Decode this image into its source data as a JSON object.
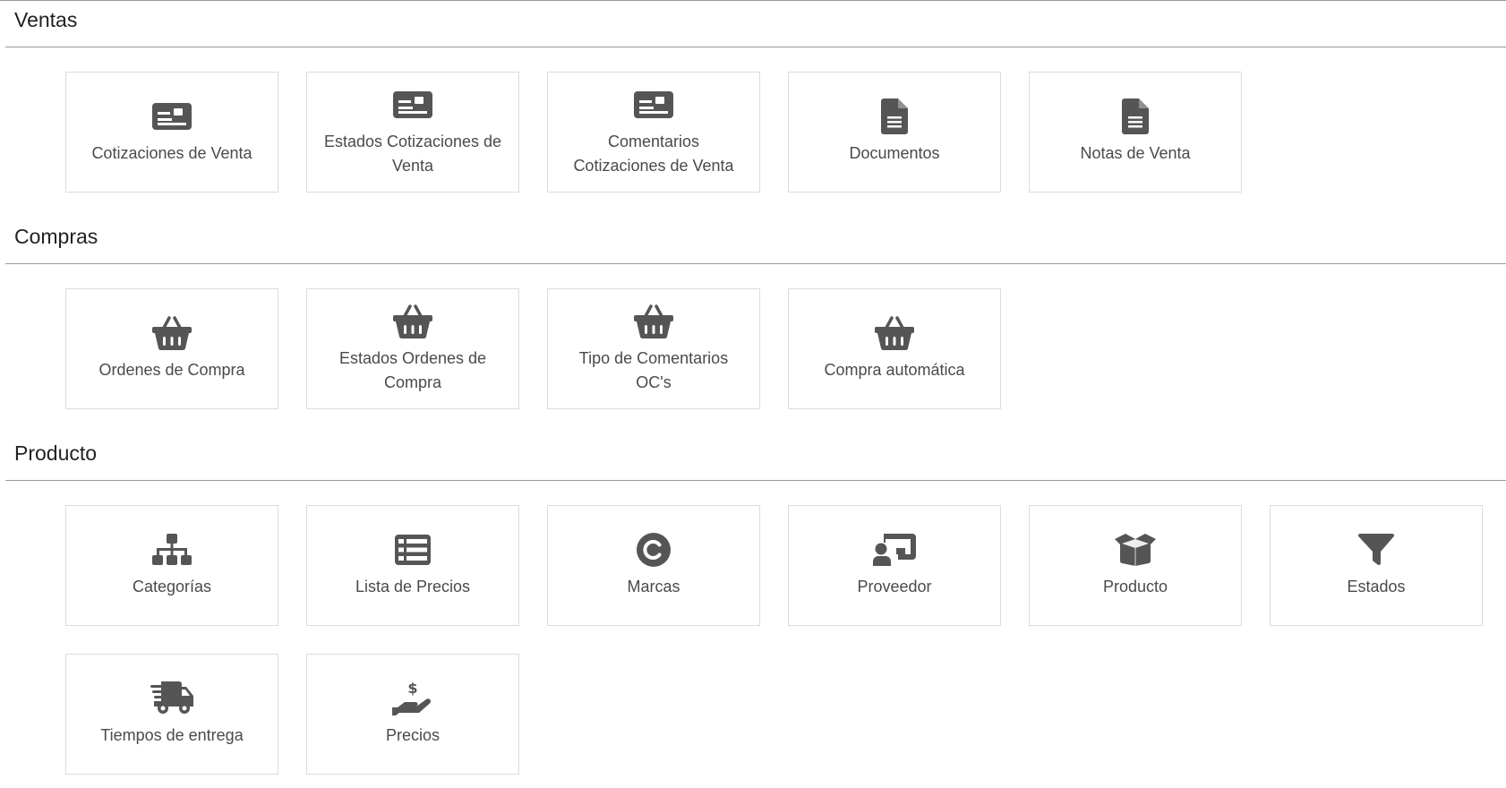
{
  "sections": {
    "ventas": {
      "title": "Ventas",
      "tiles": [
        {
          "label": "Cotizaciones de Venta",
          "icon": "id-card-icon"
        },
        {
          "label": "Estados Cotizaciones de Venta",
          "icon": "id-card-icon"
        },
        {
          "label": "Comentarios Cotizaciones de Venta",
          "icon": "id-card-icon"
        },
        {
          "label": "Documentos",
          "icon": "file-lines-icon"
        },
        {
          "label": "Notas de Venta",
          "icon": "file-lines-icon"
        }
      ]
    },
    "compras": {
      "title": "Compras",
      "tiles": [
        {
          "label": "Ordenes de Compra",
          "icon": "basket-icon"
        },
        {
          "label": "Estados Ordenes de Compra",
          "icon": "basket-icon"
        },
        {
          "label": "Tipo de Comentarios OC's",
          "icon": "basket-icon"
        },
        {
          "label": "Compra automática",
          "icon": "basket-icon"
        }
      ]
    },
    "producto": {
      "title": "Producto",
      "tiles": [
        {
          "label": "Categorías",
          "icon": "sitemap-icon"
        },
        {
          "label": "Lista de Precios",
          "icon": "list-icon"
        },
        {
          "label": "Marcas",
          "icon": "copyright-icon"
        },
        {
          "label": "Proveedor",
          "icon": "chalkboard-user-icon"
        },
        {
          "label": "Producto",
          "icon": "box-open-icon"
        },
        {
          "label": "Estados",
          "icon": "filter-icon"
        },
        {
          "label": "Tiempos de entrega",
          "icon": "truck-fast-icon"
        },
        {
          "label": "Precios",
          "icon": "hand-holding-dollar-icon"
        }
      ]
    }
  },
  "colors": {
    "icon": "#555555",
    "tile_border": "#dcdcdc",
    "rule": "#9a9a9a",
    "text": "#4a4a4a"
  }
}
